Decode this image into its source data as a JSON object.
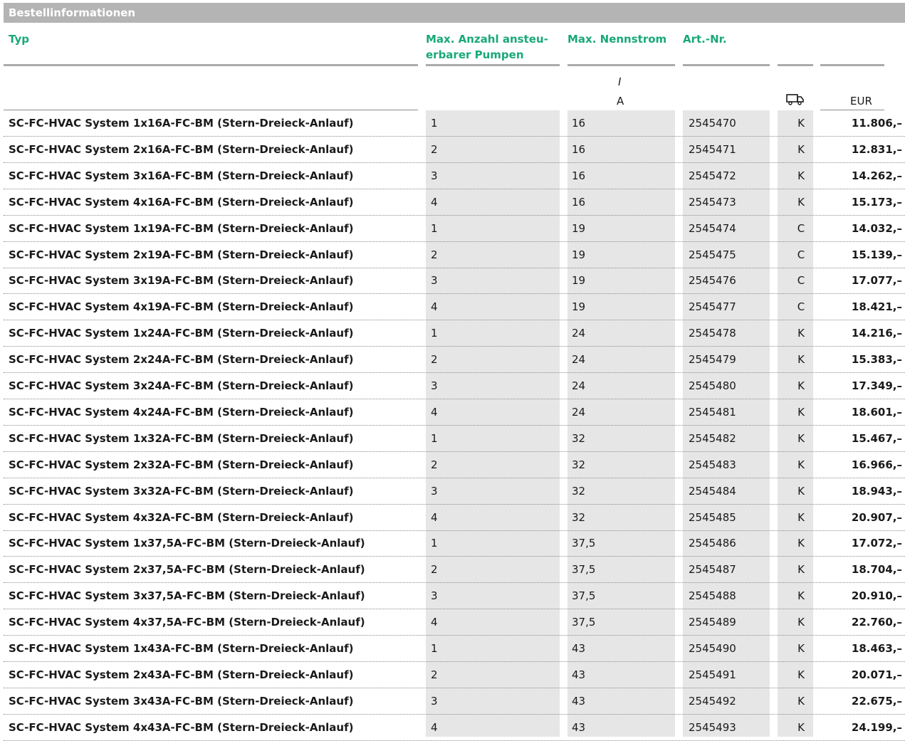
{
  "section_title": "Bestellinformationen",
  "columns": {
    "typ": "Typ",
    "pumps": "Max. Anzahl ansteu-erbarer Pumpen",
    "pumps_line1": "Max. Anzahl ansteu-",
    "pumps_line2": "erbarer Pumpen",
    "current": "Max. Nennstrom",
    "article": "Art.-Nr.",
    "delivery_icon": "truck-icon",
    "price": "EUR"
  },
  "units": {
    "current_symbol": "I",
    "current_unit": "A",
    "price_unit": "EUR"
  },
  "colors": {
    "accent": "#19a87a",
    "header_bar": "#b4b4b4",
    "column_shade": "#e6e6e6"
  },
  "rows": [
    {
      "typ": "SC-FC-HVAC System 1x16A-FC-BM (Stern-Dreieck-Anlauf)",
      "pumps": "1",
      "current": "16",
      "article": "2545470",
      "delivery": "K",
      "price": "11.806,–"
    },
    {
      "typ": "SC-FC-HVAC System 2x16A-FC-BM (Stern-Dreieck-Anlauf)",
      "pumps": "2",
      "current": "16",
      "article": "2545471",
      "delivery": "K",
      "price": "12.831,–"
    },
    {
      "typ": "SC-FC-HVAC System 3x16A-FC-BM (Stern-Dreieck-Anlauf)",
      "pumps": "3",
      "current": "16",
      "article": "2545472",
      "delivery": "K",
      "price": "14.262,–"
    },
    {
      "typ": "SC-FC-HVAC System 4x16A-FC-BM (Stern-Dreieck-Anlauf)",
      "pumps": "4",
      "current": "16",
      "article": "2545473",
      "delivery": "K",
      "price": "15.173,–"
    },
    {
      "typ": "SC-FC-HVAC System 1x19A-FC-BM (Stern-Dreieck-Anlauf)",
      "pumps": "1",
      "current": "19",
      "article": "2545474",
      "delivery": "C",
      "price": "14.032,–"
    },
    {
      "typ": "SC-FC-HVAC System 2x19A-FC-BM (Stern-Dreieck-Anlauf)",
      "pumps": "2",
      "current": "19",
      "article": "2545475",
      "delivery": "C",
      "price": "15.139,–"
    },
    {
      "typ": "SC-FC-HVAC System 3x19A-FC-BM (Stern-Dreieck-Anlauf)",
      "pumps": "3",
      "current": "19",
      "article": "2545476",
      "delivery": "C",
      "price": "17.077,–"
    },
    {
      "typ": "SC-FC-HVAC System 4x19A-FC-BM (Stern-Dreieck-Anlauf)",
      "pumps": "4",
      "current": "19",
      "article": "2545477",
      "delivery": "C",
      "price": "18.421,–"
    },
    {
      "typ": "SC-FC-HVAC System 1x24A-FC-BM (Stern-Dreieck-Anlauf)",
      "pumps": "1",
      "current": "24",
      "article": "2545478",
      "delivery": "K",
      "price": "14.216,–"
    },
    {
      "typ": "SC-FC-HVAC System 2x24A-FC-BM (Stern-Dreieck-Anlauf)",
      "pumps": "2",
      "current": "24",
      "article": "2545479",
      "delivery": "K",
      "price": "15.383,–"
    },
    {
      "typ": "SC-FC-HVAC System 3x24A-FC-BM (Stern-Dreieck-Anlauf)",
      "pumps": "3",
      "current": "24",
      "article": "2545480",
      "delivery": "K",
      "price": "17.349,–"
    },
    {
      "typ": "SC-FC-HVAC System 4x24A-FC-BM (Stern-Dreieck-Anlauf)",
      "pumps": "4",
      "current": "24",
      "article": "2545481",
      "delivery": "K",
      "price": "18.601,–"
    },
    {
      "typ": "SC-FC-HVAC System 1x32A-FC-BM (Stern-Dreieck-Anlauf)",
      "pumps": "1",
      "current": "32",
      "article": "2545482",
      "delivery": "K",
      "price": "15.467,–"
    },
    {
      "typ": "SC-FC-HVAC System 2x32A-FC-BM (Stern-Dreieck-Anlauf)",
      "pumps": "2",
      "current": "32",
      "article": "2545483",
      "delivery": "K",
      "price": "16.966,–"
    },
    {
      "typ": "SC-FC-HVAC System 3x32A-FC-BM (Stern-Dreieck-Anlauf)",
      "pumps": "3",
      "current": "32",
      "article": "2545484",
      "delivery": "K",
      "price": "18.943,–"
    },
    {
      "typ": "SC-FC-HVAC System 4x32A-FC-BM (Stern-Dreieck-Anlauf)",
      "pumps": "4",
      "current": "32",
      "article": "2545485",
      "delivery": "K",
      "price": "20.907,–"
    },
    {
      "typ": "SC-FC-HVAC System 1x37,5A-FC-BM (Stern-Dreieck-Anlauf)",
      "pumps": "1",
      "current": "37,5",
      "article": "2545486",
      "delivery": "K",
      "price": "17.072,–"
    },
    {
      "typ": "SC-FC-HVAC System 2x37,5A-FC-BM (Stern-Dreieck-Anlauf)",
      "pumps": "2",
      "current": "37,5",
      "article": "2545487",
      "delivery": "K",
      "price": "18.704,–"
    },
    {
      "typ": "SC-FC-HVAC System 3x37,5A-FC-BM (Stern-Dreieck-Anlauf)",
      "pumps": "3",
      "current": "37,5",
      "article": "2545488",
      "delivery": "K",
      "price": "20.910,–"
    },
    {
      "typ": "SC-FC-HVAC System 4x37,5A-FC-BM (Stern-Dreieck-Anlauf)",
      "pumps": "4",
      "current": "37,5",
      "article": "2545489",
      "delivery": "K",
      "price": "22.760,–"
    },
    {
      "typ": "SC-FC-HVAC System 1x43A-FC-BM (Stern-Dreieck-Anlauf)",
      "pumps": "1",
      "current": "43",
      "article": "2545490",
      "delivery": "K",
      "price": "18.463,–"
    },
    {
      "typ": "SC-FC-HVAC System 2x43A-FC-BM (Stern-Dreieck-Anlauf)",
      "pumps": "2",
      "current": "43",
      "article": "2545491",
      "delivery": "K",
      "price": "20.071,–"
    },
    {
      "typ": "SC-FC-HVAC System 3x43A-FC-BM (Stern-Dreieck-Anlauf)",
      "pumps": "3",
      "current": "43",
      "article": "2545492",
      "delivery": "K",
      "price": "22.675,–"
    },
    {
      "typ": "SC-FC-HVAC System 4x43A-FC-BM (Stern-Dreieck-Anlauf)",
      "pumps": "4",
      "current": "43",
      "article": "2545493",
      "delivery": "K",
      "price": "24.199,–"
    }
  ]
}
